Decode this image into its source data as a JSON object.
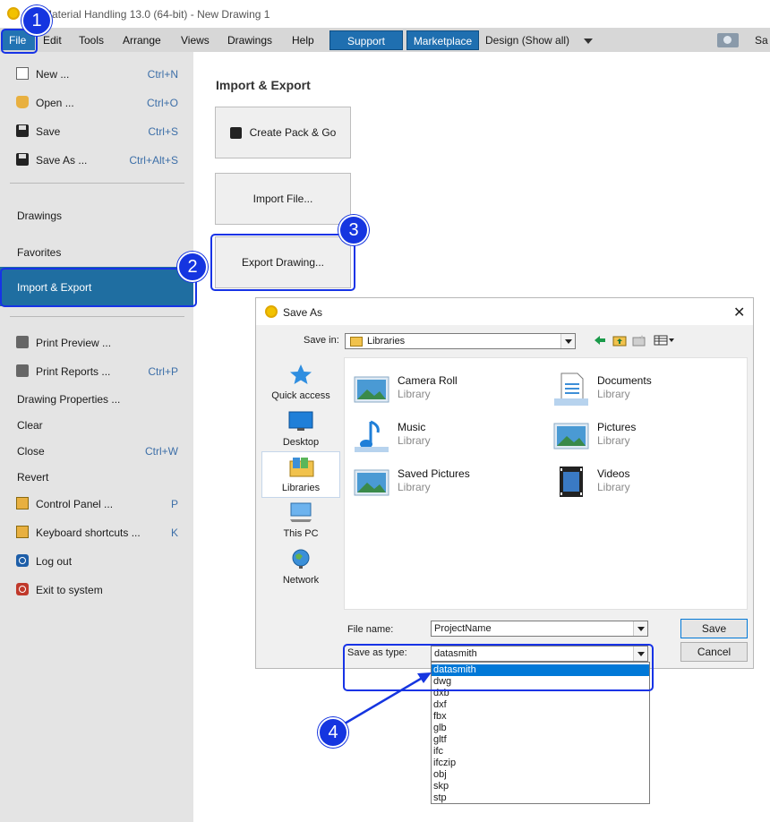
{
  "window": {
    "title": "Material Handling 13.0 (64-bit) - New Drawing 1"
  },
  "menubar": {
    "items": [
      "File",
      "Edit",
      "Tools",
      "Arrange",
      "Views",
      "Drawings",
      "Help"
    ],
    "support": "Support",
    "marketplace": "Marketplace",
    "design_mode": "Design (Show all)",
    "save_truncated": "Sa"
  },
  "sidebar": {
    "top_items": [
      {
        "label": "New ...",
        "shortcut": "Ctrl+N",
        "icon": "new-document-icon"
      },
      {
        "label": "Open ...",
        "shortcut": "Ctrl+O",
        "icon": "open-folder-icon"
      },
      {
        "label": "Save",
        "shortcut": "Ctrl+S",
        "icon": "save-icon"
      },
      {
        "label": "Save As ...",
        "shortcut": "Ctrl+Alt+S",
        "icon": "save-as-icon"
      }
    ],
    "sections": [
      "Drawings",
      "Favorites",
      "Import & Export"
    ],
    "bottom_items": [
      {
        "label": "Print Preview ...",
        "shortcut": "",
        "icon": "print-preview-icon"
      },
      {
        "label": "Print Reports ...",
        "shortcut": "Ctrl+P",
        "icon": "print-icon"
      },
      {
        "label": "Drawing Properties ...",
        "shortcut": "",
        "icon": ""
      },
      {
        "label": "Clear",
        "shortcut": "",
        "icon": ""
      },
      {
        "label": "Close",
        "shortcut": "Ctrl+W",
        "icon": ""
      },
      {
        "label": "Revert",
        "shortcut": "",
        "icon": ""
      },
      {
        "label": "Control Panel ...",
        "shortcut": "P",
        "icon": "control-panel-icon"
      },
      {
        "label": "Keyboard shortcuts ...",
        "shortcut": "K",
        "icon": "keyboard-icon"
      },
      {
        "label": "Log out",
        "shortcut": "",
        "icon": "logout-icon"
      },
      {
        "label": "Exit to system",
        "shortcut": "",
        "icon": "exit-icon"
      }
    ]
  },
  "main": {
    "title": "Import & Export",
    "buttons": [
      "Create Pack & Go",
      "Import File...",
      "Export Drawing..."
    ]
  },
  "dialog": {
    "title": "Save As",
    "save_in_label": "Save in:",
    "save_in_value": "Libraries",
    "places": [
      "Quick access",
      "Desktop",
      "Libraries",
      "This PC",
      "Network"
    ],
    "libraries": [
      {
        "name": "Camera Roll",
        "type": "Library"
      },
      {
        "name": "Documents",
        "type": "Library"
      },
      {
        "name": "Music",
        "type": "Library"
      },
      {
        "name": "Pictures",
        "type": "Library"
      },
      {
        "name": "Saved Pictures",
        "type": "Library"
      },
      {
        "name": "Videos",
        "type": "Library"
      }
    ],
    "file_name_label": "File name:",
    "file_name_value": "ProjectName",
    "save_type_label": "Save as type:",
    "save_type_value": "datasmith",
    "save_button": "Save",
    "cancel_button": "Cancel",
    "type_options": [
      "datasmith",
      "dwg",
      "dxb",
      "dxf",
      "fbx",
      "glb",
      "gltf",
      "ifc",
      "ifczip",
      "obj",
      "skp",
      "stp"
    ]
  },
  "callouts": [
    "1",
    "2",
    "3",
    "4"
  ],
  "colors": {
    "accent": "#1f6ea1",
    "callout": "#1535e0",
    "selection": "#0078d7"
  }
}
